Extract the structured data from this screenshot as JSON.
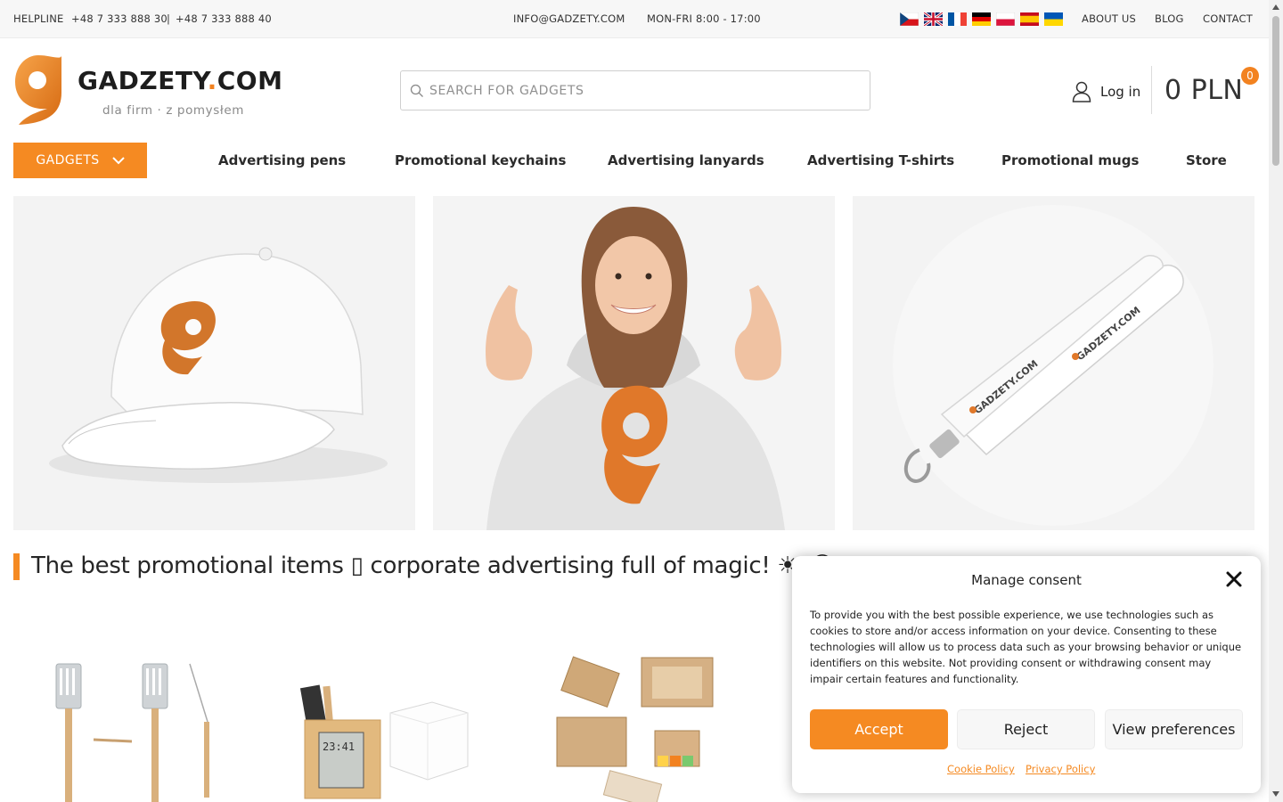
{
  "topbar": {
    "helpline_label": "HELPLINE",
    "phone_1": "+48 7 333 888 30",
    "separator": "|",
    "phone_2": "+48 7 333 888 40",
    "email": "INFO@GADZETY.COM",
    "hours": "MON-FRI 8:00 - 17:00",
    "languages": [
      "cz-flag-icon",
      "gb-flag-icon",
      "fr-flag-icon",
      "de-flag-icon",
      "pl-flag-icon",
      "es-flag-icon",
      "ua-flag-icon"
    ],
    "links": {
      "about": "ABOUT US",
      "blog": "BLOG",
      "contact": "CONTACT"
    }
  },
  "header": {
    "logo_name_main": "GADZETY",
    "logo_name_dot": ".",
    "logo_name_tld": "COM",
    "logo_tagline": "dla firm · z pomysłem",
    "search_placeholder": "SEARCH FOR GADGETS",
    "login_label": "Log in",
    "cart_total": "0 PLN",
    "cart_count": "0"
  },
  "nav": {
    "gadgets_label": "GADGETS",
    "items": [
      "Advertising pens",
      "Promotional keychains",
      "Advertising lanyards",
      "Advertising T-shirts",
      "Promotional mugs",
      "Store"
    ]
  },
  "hero": {
    "lanyard_print": "GADZETY.COM"
  },
  "main": {
    "headline": "The best promotional items ▯ corporate advertising full of magic! ☀▯😊"
  },
  "products": {
    "calendar_clock_digits": "23:41"
  },
  "consent": {
    "title": "Manage consent",
    "text": "To provide you with the best possible experience, we use technologies such as cookies to store and/or access information on your device. Consenting to these technologies will allow us to process data such as your browsing behavior or unique identifiers on this website. Not providing consent or withdrawing consent may impair certain features and functionality.",
    "accept": "Accept",
    "reject": "Reject",
    "preferences": "View preferences",
    "cookie_policy": "Cookie Policy",
    "privacy_policy": "Privacy Policy"
  },
  "colors": {
    "brand_orange": "#f58a22",
    "topbar_bg": "#f7f7f7",
    "text_dark": "#222222"
  }
}
